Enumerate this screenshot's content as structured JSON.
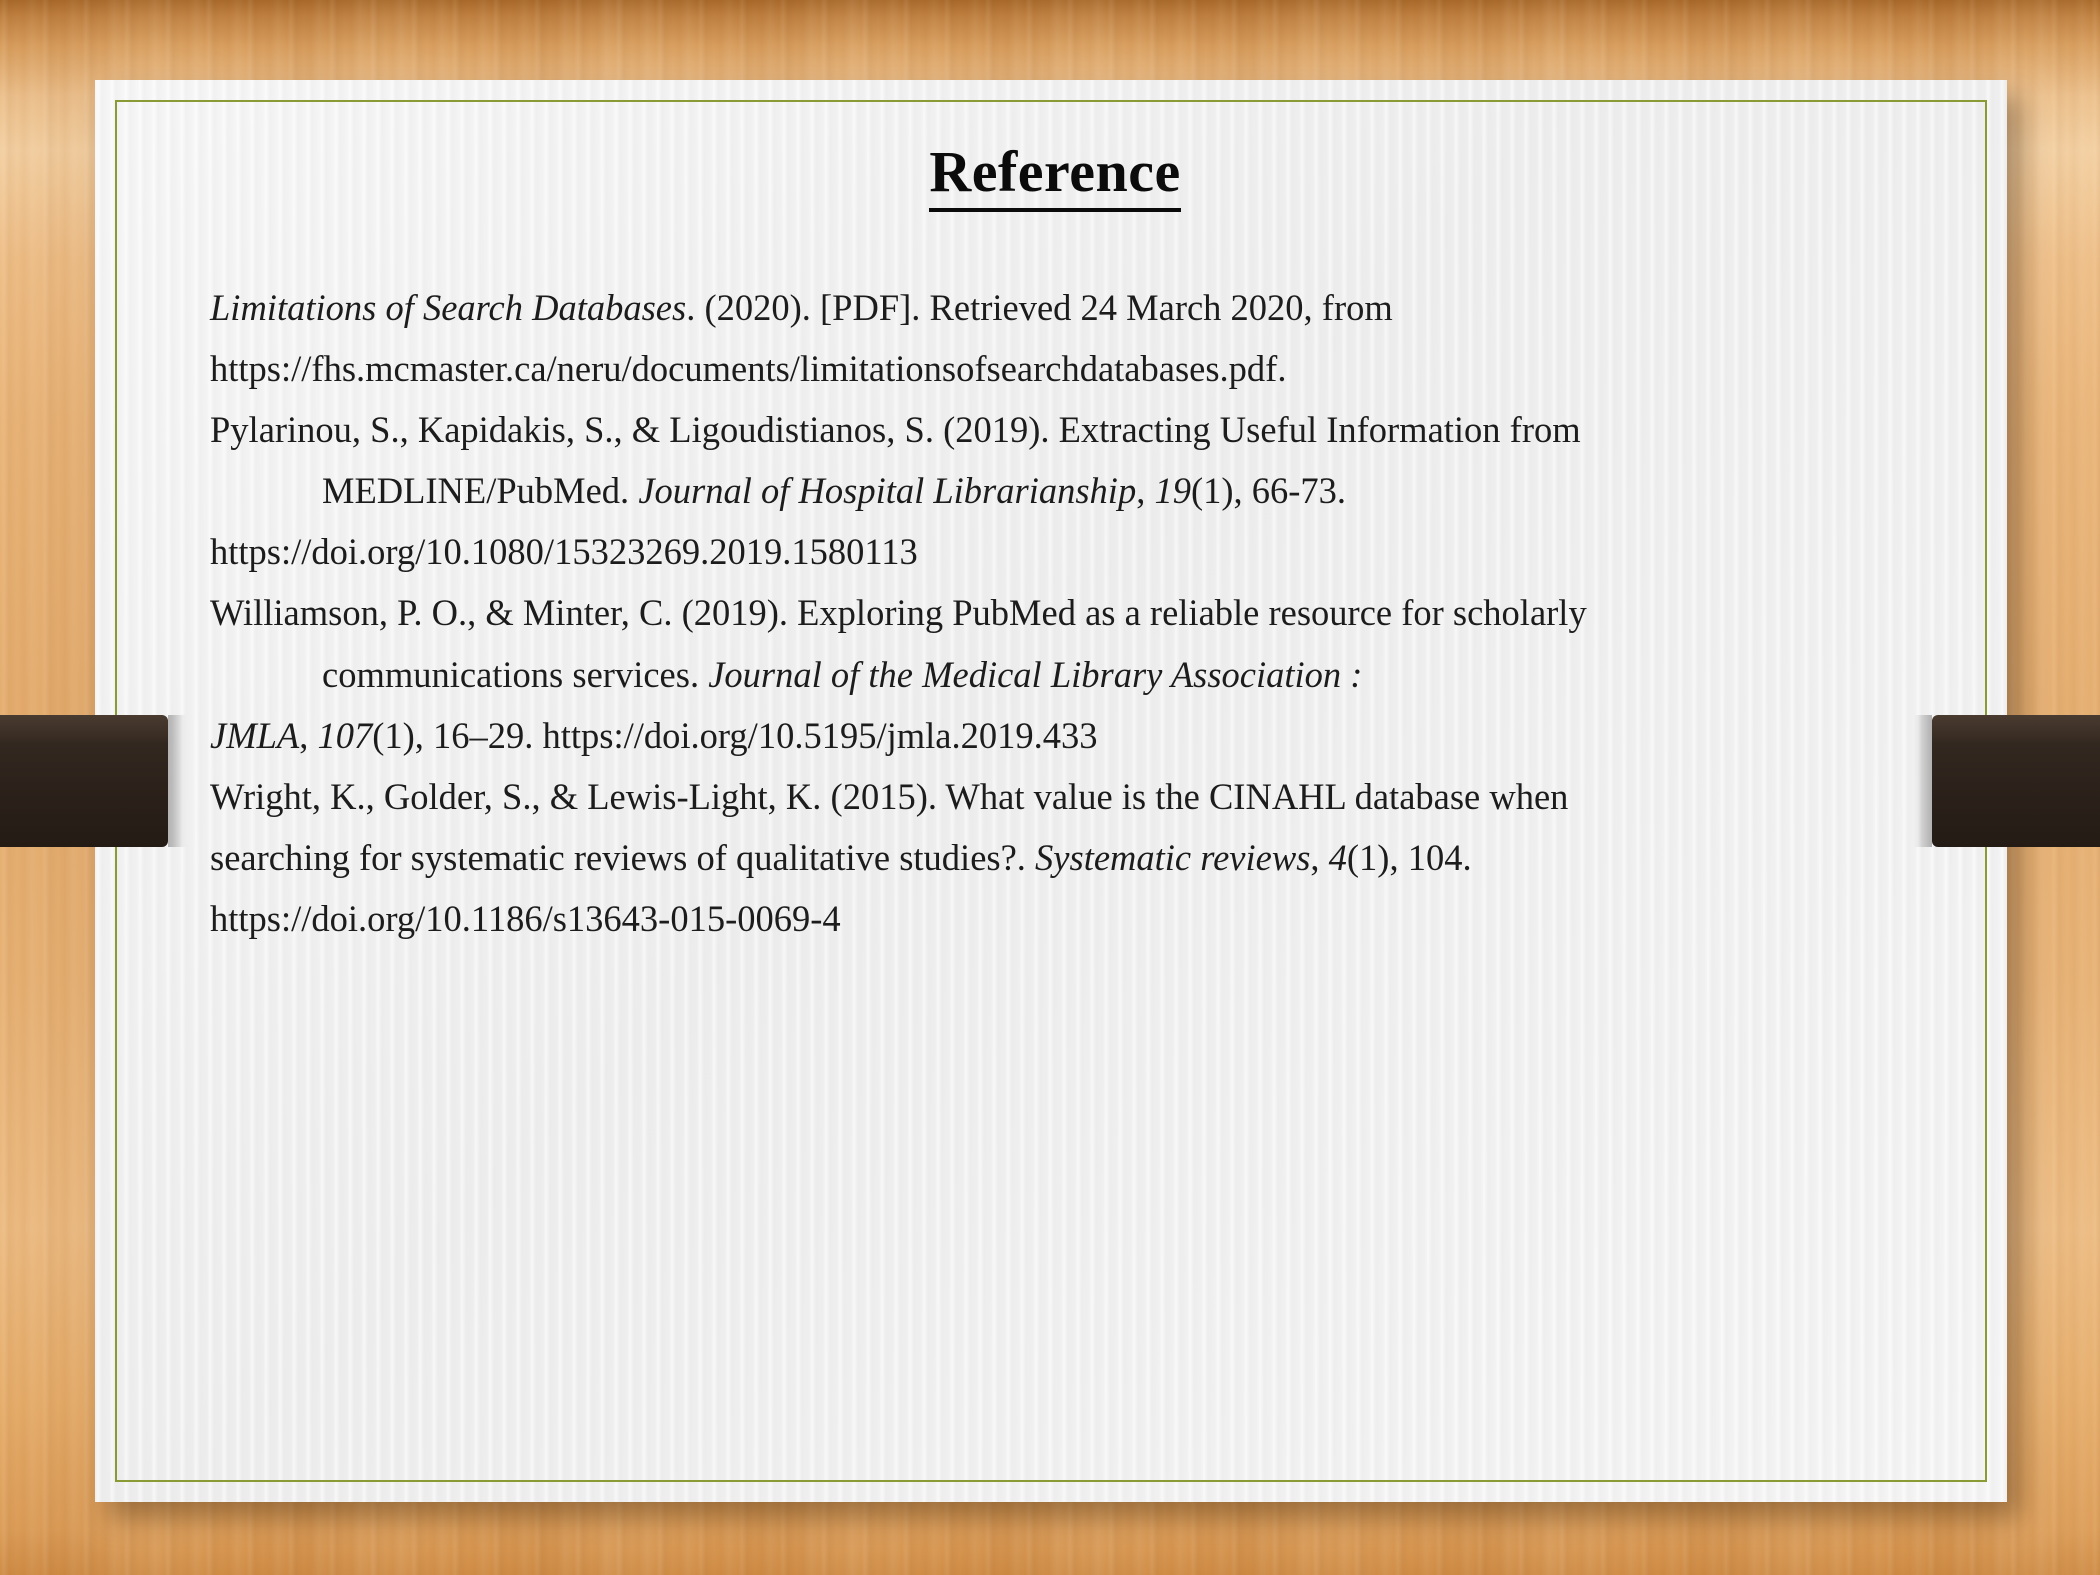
{
  "slide": {
    "title": "Reference",
    "accent_border_color": "#8a9a34",
    "paper_color": "#f1f1f1",
    "background_color": "#eaba80",
    "clip_color": "#2e241c",
    "text_color": "#1c1c1c"
  },
  "references": [
    {
      "id": "ref-limitations-of-search-databases",
      "lines": [
        {
          "justify": true,
          "parts": [
            {
              "style": "italic",
              "text": "Limitations of Search Databases"
            },
            {
              "style": "normal",
              "text": ". (2020). [PDF]. Retrieved 24 March 2020, from"
            }
          ]
        },
        {
          "justify": false,
          "parts": [
            {
              "style": "normal",
              "text": "https://fhs.mcmaster.ca/neru/documents/limitationsofsearchdatabases.pdf."
            }
          ]
        }
      ]
    },
    {
      "id": "ref-pylarinou-2019",
      "lines": [
        {
          "justify": true,
          "parts": [
            {
              "style": "normal",
              "text": "Pylarinou, S., Kapidakis, S., & Ligoudistianos, S. (2019). Extracting Useful Information from"
            }
          ]
        },
        {
          "justify": true,
          "indent": true,
          "parts": [
            {
              "style": "normal",
              "text": "MEDLINE/PubMed. "
            },
            {
              "style": "italic",
              "text": "Journal of Hospital Librarianship"
            },
            {
              "style": "normal",
              "text": ", "
            },
            {
              "style": "italic",
              "text": "19"
            },
            {
              "style": "normal",
              "text": "(1),   66-73."
            }
          ]
        },
        {
          "justify": false,
          "parts": [
            {
              "style": "normal",
              "text": "https://doi.org/10.1080/15323269.2019.1580113"
            }
          ]
        }
      ]
    },
    {
      "id": "ref-williamson-2019",
      "lines": [
        {
          "justify": true,
          "parts": [
            {
              "style": "normal",
              "text": "Williamson, P. O., & Minter, C. (2019). Exploring PubMed as a reliable resource for scholarly"
            }
          ]
        },
        {
          "justify": true,
          "indent": true,
          "parts": [
            {
              "style": "normal",
              "text": "communications services. "
            },
            {
              "style": "italic",
              "text": "Journal of the Medical Library Association :"
            }
          ]
        },
        {
          "justify": false,
          "parts": [
            {
              "style": "italic",
              "text": "JMLA"
            },
            {
              "style": "normal",
              "text": ", "
            },
            {
              "style": "italic",
              "text": "107"
            },
            {
              "style": "normal",
              "text": "(1), 16–29. https://doi.org/10.5195/jmla.2019.433"
            }
          ]
        }
      ]
    },
    {
      "id": "ref-wright-2015",
      "lines": [
        {
          "justify": true,
          "parts": [
            {
              "style": "normal",
              "text": "Wright, K., Golder, S., & Lewis-Light, K. (2015). What value is the CINAHL database when"
            }
          ]
        },
        {
          "justify": true,
          "parts": [
            {
              "style": "normal",
              "text": "searching for systematic reviews of qualitative studies?. "
            },
            {
              "style": "italic",
              "text": "Systematic reviews"
            },
            {
              "style": "normal",
              "text": ", "
            },
            {
              "style": "italic",
              "text": "4"
            },
            {
              "style": "normal",
              "text": "(1),    104."
            }
          ]
        },
        {
          "justify": false,
          "parts": [
            {
              "style": "normal",
              "text": "https://doi.org/10.1186/s13643-015-0069-4"
            }
          ]
        }
      ]
    }
  ]
}
